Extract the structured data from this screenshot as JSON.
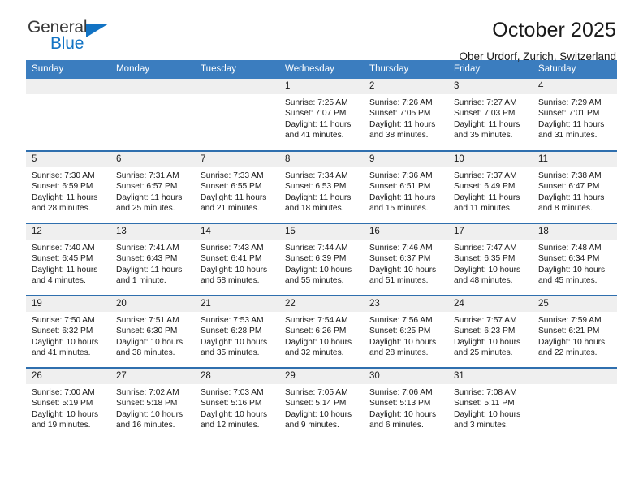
{
  "brand": {
    "name_part1": "General",
    "name_part2": "Blue",
    "accent_color": "#1273c4",
    "triangle_icon": "triangle-icon"
  },
  "header": {
    "title": "October 2025",
    "subtitle": "Ober Urdorf, Zurich, Switzerland"
  },
  "calendar": {
    "header_bg": "#3b7dbf",
    "row_divider": "#2f6fae",
    "daynum_bg": "#efefef",
    "weekdays": [
      "Sunday",
      "Monday",
      "Tuesday",
      "Wednesday",
      "Thursday",
      "Friday",
      "Saturday"
    ],
    "weeks": [
      [
        {
          "day": "",
          "sunrise": "",
          "sunset": "",
          "daylight_line1": "",
          "daylight_line2": "",
          "empty": true
        },
        {
          "day": "",
          "sunrise": "",
          "sunset": "",
          "daylight_line1": "",
          "daylight_line2": "",
          "empty": true
        },
        {
          "day": "",
          "sunrise": "",
          "sunset": "",
          "daylight_line1": "",
          "daylight_line2": "",
          "empty": true
        },
        {
          "day": "1",
          "sunrise": "Sunrise: 7:25 AM",
          "sunset": "Sunset: 7:07 PM",
          "daylight_line1": "Daylight: 11 hours",
          "daylight_line2": "and 41 minutes."
        },
        {
          "day": "2",
          "sunrise": "Sunrise: 7:26 AM",
          "sunset": "Sunset: 7:05 PM",
          "daylight_line1": "Daylight: 11 hours",
          "daylight_line2": "and 38 minutes."
        },
        {
          "day": "3",
          "sunrise": "Sunrise: 7:27 AM",
          "sunset": "Sunset: 7:03 PM",
          "daylight_line1": "Daylight: 11 hours",
          "daylight_line2": "and 35 minutes."
        },
        {
          "day": "4",
          "sunrise": "Sunrise: 7:29 AM",
          "sunset": "Sunset: 7:01 PM",
          "daylight_line1": "Daylight: 11 hours",
          "daylight_line2": "and 31 minutes."
        }
      ],
      [
        {
          "day": "5",
          "sunrise": "Sunrise: 7:30 AM",
          "sunset": "Sunset: 6:59 PM",
          "daylight_line1": "Daylight: 11 hours",
          "daylight_line2": "and 28 minutes."
        },
        {
          "day": "6",
          "sunrise": "Sunrise: 7:31 AM",
          "sunset": "Sunset: 6:57 PM",
          "daylight_line1": "Daylight: 11 hours",
          "daylight_line2": "and 25 minutes."
        },
        {
          "day": "7",
          "sunrise": "Sunrise: 7:33 AM",
          "sunset": "Sunset: 6:55 PM",
          "daylight_line1": "Daylight: 11 hours",
          "daylight_line2": "and 21 minutes."
        },
        {
          "day": "8",
          "sunrise": "Sunrise: 7:34 AM",
          "sunset": "Sunset: 6:53 PM",
          "daylight_line1": "Daylight: 11 hours",
          "daylight_line2": "and 18 minutes."
        },
        {
          "day": "9",
          "sunrise": "Sunrise: 7:36 AM",
          "sunset": "Sunset: 6:51 PM",
          "daylight_line1": "Daylight: 11 hours",
          "daylight_line2": "and 15 minutes."
        },
        {
          "day": "10",
          "sunrise": "Sunrise: 7:37 AM",
          "sunset": "Sunset: 6:49 PM",
          "daylight_line1": "Daylight: 11 hours",
          "daylight_line2": "and 11 minutes."
        },
        {
          "day": "11",
          "sunrise": "Sunrise: 7:38 AM",
          "sunset": "Sunset: 6:47 PM",
          "daylight_line1": "Daylight: 11 hours",
          "daylight_line2": "and 8 minutes."
        }
      ],
      [
        {
          "day": "12",
          "sunrise": "Sunrise: 7:40 AM",
          "sunset": "Sunset: 6:45 PM",
          "daylight_line1": "Daylight: 11 hours",
          "daylight_line2": "and 4 minutes."
        },
        {
          "day": "13",
          "sunrise": "Sunrise: 7:41 AM",
          "sunset": "Sunset: 6:43 PM",
          "daylight_line1": "Daylight: 11 hours",
          "daylight_line2": "and 1 minute."
        },
        {
          "day": "14",
          "sunrise": "Sunrise: 7:43 AM",
          "sunset": "Sunset: 6:41 PM",
          "daylight_line1": "Daylight: 10 hours",
          "daylight_line2": "and 58 minutes."
        },
        {
          "day": "15",
          "sunrise": "Sunrise: 7:44 AM",
          "sunset": "Sunset: 6:39 PM",
          "daylight_line1": "Daylight: 10 hours",
          "daylight_line2": "and 55 minutes."
        },
        {
          "day": "16",
          "sunrise": "Sunrise: 7:46 AM",
          "sunset": "Sunset: 6:37 PM",
          "daylight_line1": "Daylight: 10 hours",
          "daylight_line2": "and 51 minutes."
        },
        {
          "day": "17",
          "sunrise": "Sunrise: 7:47 AM",
          "sunset": "Sunset: 6:35 PM",
          "daylight_line1": "Daylight: 10 hours",
          "daylight_line2": "and 48 minutes."
        },
        {
          "day": "18",
          "sunrise": "Sunrise: 7:48 AM",
          "sunset": "Sunset: 6:34 PM",
          "daylight_line1": "Daylight: 10 hours",
          "daylight_line2": "and 45 minutes."
        }
      ],
      [
        {
          "day": "19",
          "sunrise": "Sunrise: 7:50 AM",
          "sunset": "Sunset: 6:32 PM",
          "daylight_line1": "Daylight: 10 hours",
          "daylight_line2": "and 41 minutes."
        },
        {
          "day": "20",
          "sunrise": "Sunrise: 7:51 AM",
          "sunset": "Sunset: 6:30 PM",
          "daylight_line1": "Daylight: 10 hours",
          "daylight_line2": "and 38 minutes."
        },
        {
          "day": "21",
          "sunrise": "Sunrise: 7:53 AM",
          "sunset": "Sunset: 6:28 PM",
          "daylight_line1": "Daylight: 10 hours",
          "daylight_line2": "and 35 minutes."
        },
        {
          "day": "22",
          "sunrise": "Sunrise: 7:54 AM",
          "sunset": "Sunset: 6:26 PM",
          "daylight_line1": "Daylight: 10 hours",
          "daylight_line2": "and 32 minutes."
        },
        {
          "day": "23",
          "sunrise": "Sunrise: 7:56 AM",
          "sunset": "Sunset: 6:25 PM",
          "daylight_line1": "Daylight: 10 hours",
          "daylight_line2": "and 28 minutes."
        },
        {
          "day": "24",
          "sunrise": "Sunrise: 7:57 AM",
          "sunset": "Sunset: 6:23 PM",
          "daylight_line1": "Daylight: 10 hours",
          "daylight_line2": "and 25 minutes."
        },
        {
          "day": "25",
          "sunrise": "Sunrise: 7:59 AM",
          "sunset": "Sunset: 6:21 PM",
          "daylight_line1": "Daylight: 10 hours",
          "daylight_line2": "and 22 minutes."
        }
      ],
      [
        {
          "day": "26",
          "sunrise": "Sunrise: 7:00 AM",
          "sunset": "Sunset: 5:19 PM",
          "daylight_line1": "Daylight: 10 hours",
          "daylight_line2": "and 19 minutes."
        },
        {
          "day": "27",
          "sunrise": "Sunrise: 7:02 AM",
          "sunset": "Sunset: 5:18 PM",
          "daylight_line1": "Daylight: 10 hours",
          "daylight_line2": "and 16 minutes."
        },
        {
          "day": "28",
          "sunrise": "Sunrise: 7:03 AM",
          "sunset": "Sunset: 5:16 PM",
          "daylight_line1": "Daylight: 10 hours",
          "daylight_line2": "and 12 minutes."
        },
        {
          "day": "29",
          "sunrise": "Sunrise: 7:05 AM",
          "sunset": "Sunset: 5:14 PM",
          "daylight_line1": "Daylight: 10 hours",
          "daylight_line2": "and 9 minutes."
        },
        {
          "day": "30",
          "sunrise": "Sunrise: 7:06 AM",
          "sunset": "Sunset: 5:13 PM",
          "daylight_line1": "Daylight: 10 hours",
          "daylight_line2": "and 6 minutes."
        },
        {
          "day": "31",
          "sunrise": "Sunrise: 7:08 AM",
          "sunset": "Sunset: 5:11 PM",
          "daylight_line1": "Daylight: 10 hours",
          "daylight_line2": "and 3 minutes."
        },
        {
          "day": "",
          "sunrise": "",
          "sunset": "",
          "daylight_line1": "",
          "daylight_line2": "",
          "empty": true
        }
      ]
    ]
  }
}
